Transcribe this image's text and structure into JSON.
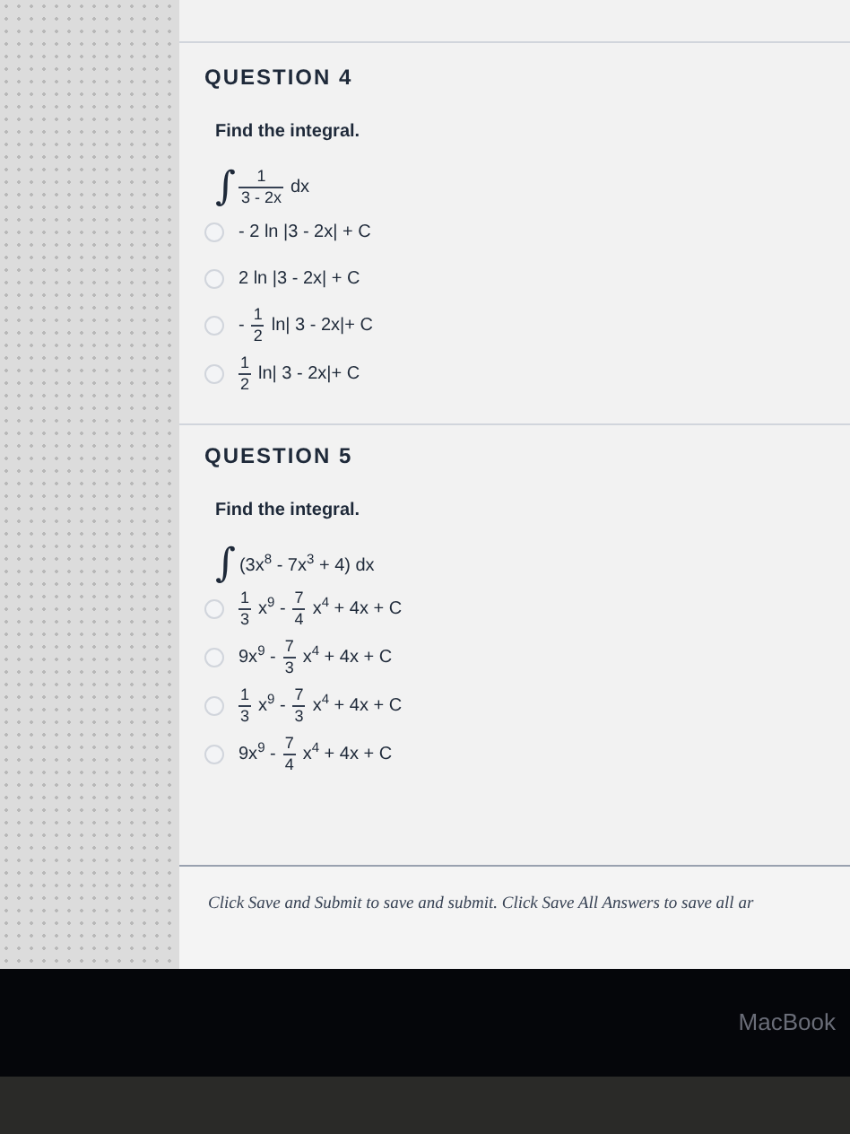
{
  "questions": [
    {
      "title": "QUESTION 4",
      "prompt": "Find the integral.",
      "integral": [
        {
          "kind": "sign",
          "text": "∫"
        },
        {
          "kind": "frac",
          "num": "1",
          "den": "3 - 2x"
        },
        {
          "kind": "text",
          "text": "dx"
        }
      ],
      "options": [
        {
          "selected": false,
          "parts": [
            {
              "kind": "text",
              "text": "- 2 ln |3 - 2x| + C"
            }
          ]
        },
        {
          "selected": false,
          "parts": [
            {
              "kind": "text",
              "text": "2 ln |3 - 2x| + C"
            }
          ]
        },
        {
          "selected": false,
          "parts": [
            {
              "kind": "text",
              "text": "-"
            },
            {
              "kind": "frac",
              "num": "1",
              "den": "2"
            },
            {
              "kind": "text",
              "text": "ln| 3 - 2x|+ C"
            }
          ]
        },
        {
          "selected": false,
          "parts": [
            {
              "kind": "frac",
              "num": "1",
              "den": "2"
            },
            {
              "kind": "text",
              "text": "ln| 3 - 2x|+ C"
            }
          ]
        }
      ]
    },
    {
      "title": "QUESTION 5",
      "prompt": "Find the integral.",
      "integral": [
        {
          "kind": "sign",
          "text": "∫"
        },
        {
          "kind": "text",
          "text": "(3x$^{8}$ - 7x$^{3}$ + 4) dx"
        }
      ],
      "options": [
        {
          "selected": false,
          "parts": [
            {
              "kind": "frac",
              "num": "1",
              "den": "3"
            },
            {
              "kind": "text",
              "text": "x$^{9}$ -"
            },
            {
              "kind": "frac",
              "num": "7",
              "den": "4"
            },
            {
              "kind": "text",
              "text": "x$^{4}$ + 4x + C"
            }
          ]
        },
        {
          "selected": false,
          "parts": [
            {
              "kind": "text",
              "text": "9x$^{9}$ -"
            },
            {
              "kind": "frac",
              "num": "7",
              "den": "3"
            },
            {
              "kind": "text",
              "text": "x$^{4}$ + 4x + C"
            }
          ]
        },
        {
          "selected": false,
          "parts": [
            {
              "kind": "frac",
              "num": "1",
              "den": "3"
            },
            {
              "kind": "text",
              "text": "x$^{9}$ -"
            },
            {
              "kind": "frac",
              "num": "7",
              "den": "3"
            },
            {
              "kind": "text",
              "text": "x$^{4}$ + 4x + C"
            }
          ]
        },
        {
          "selected": false,
          "parts": [
            {
              "kind": "text",
              "text": "9x$^{9}$ -"
            },
            {
              "kind": "frac",
              "num": "7",
              "den": "4"
            },
            {
              "kind": "text",
              "text": "x$^{4}$ + 4x + C"
            }
          ]
        }
      ]
    }
  ],
  "footer": "Click Save and Submit to save and submit. Click Save All Answers to save all ar",
  "bezel_label": "MacBook"
}
